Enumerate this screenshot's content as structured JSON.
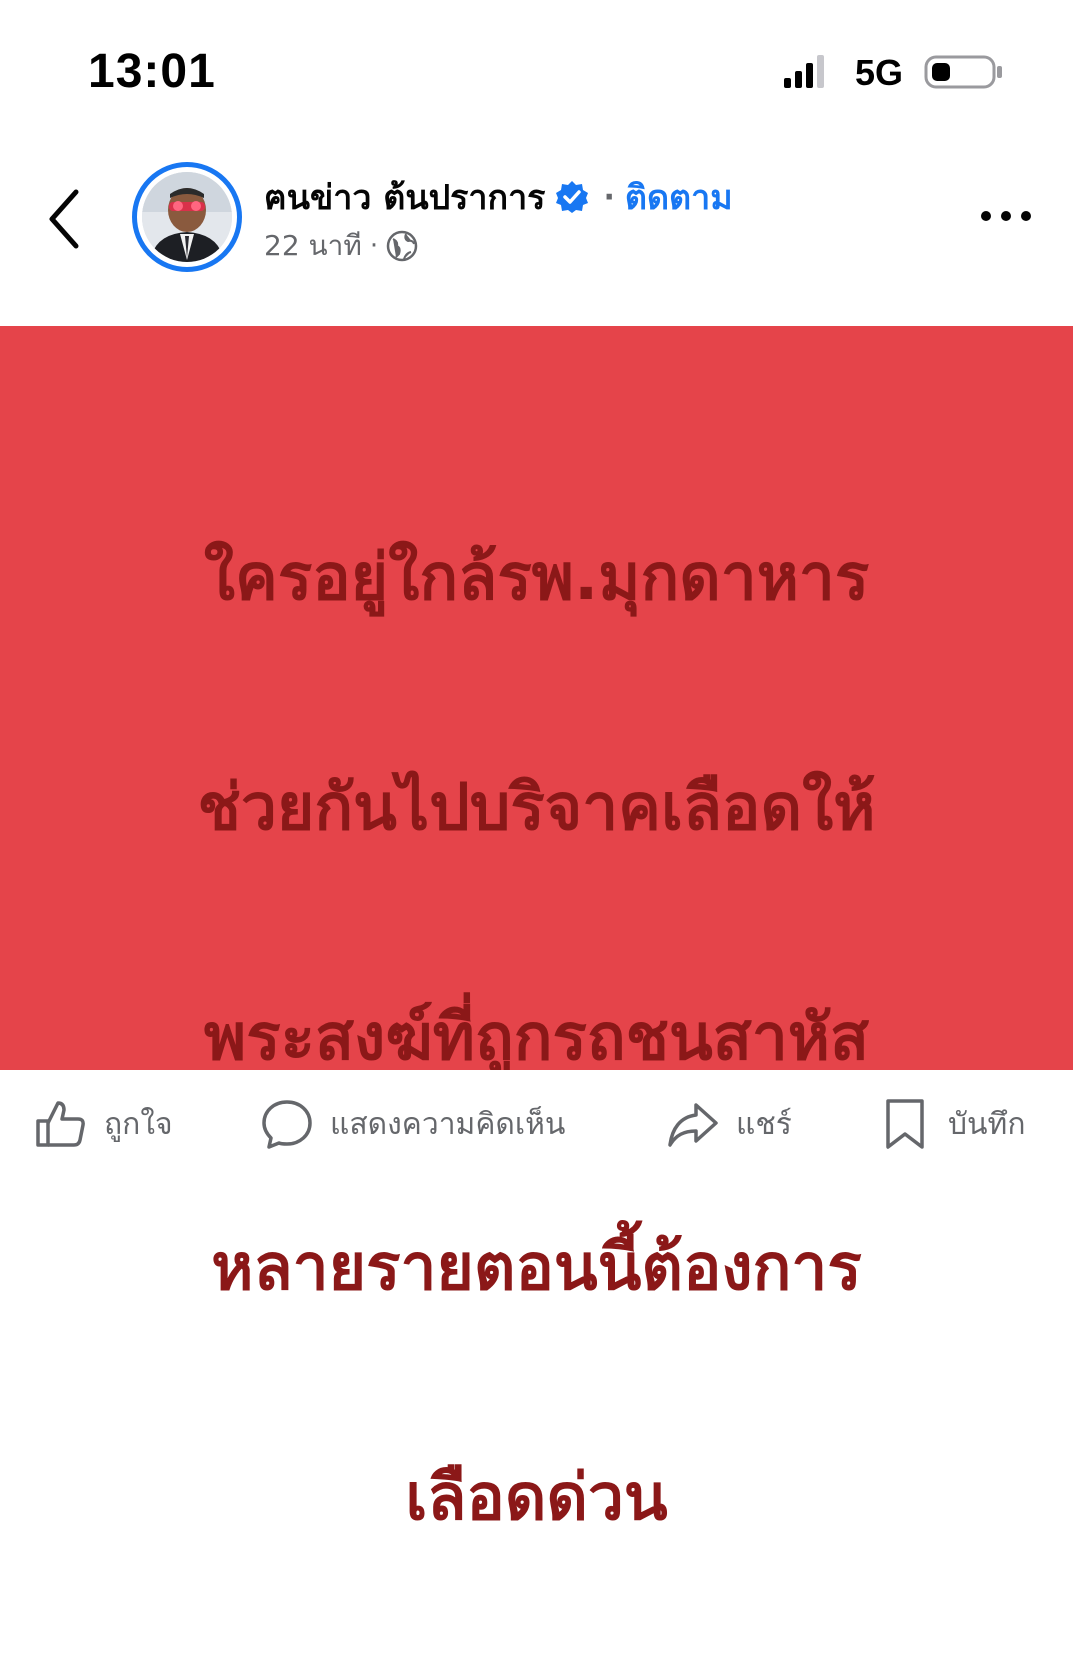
{
  "status_bar": {
    "time": "13:01",
    "network": "5G",
    "signal_bars": 3,
    "signal_bars_max": 4,
    "battery_level": 0.25
  },
  "post": {
    "author": "ฅนข่าว ต้นปราการ",
    "verified": true,
    "separator": "·",
    "follow_label": "ติดตาม",
    "timestamp": "22 นาที",
    "meta_separator": "·",
    "privacy_icon": "globe-icon",
    "text_lines": [
      "ใครอยู่ใกล้รพ.มุกดาหาร",
      "ช่วยกันไปบริจาคเลือดให้",
      "พระสงฆ์ที่ถูกรถชนสาหัส",
      "หลายรายตอนนี้ต้องการ",
      "เลือดด่วน"
    ],
    "background_color": "#e5444a",
    "text_color": "#8b1818"
  },
  "actions": {
    "like": "ถูกใจ",
    "comment": "แสดงความคิดเห็น",
    "share": "แชร์",
    "save": "บันทึก"
  },
  "colors": {
    "accent": "#1877f2",
    "secondary_text": "#65676b"
  }
}
